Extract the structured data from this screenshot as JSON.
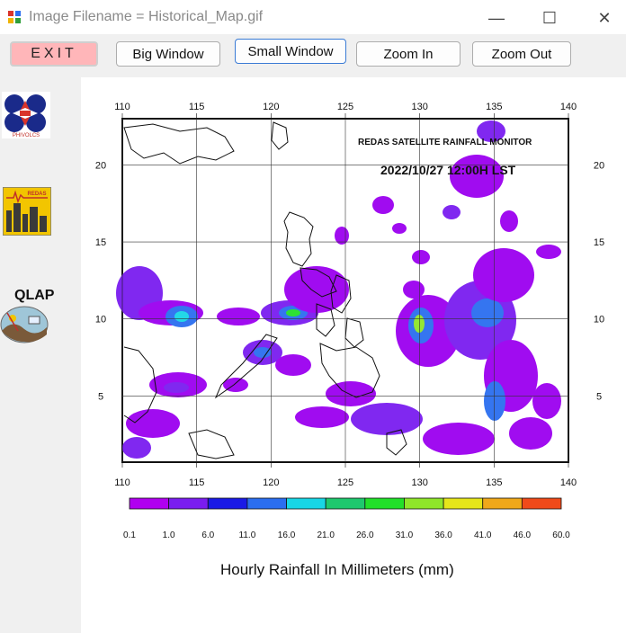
{
  "window": {
    "title": "Image Filename = Historical_Map.gif",
    "controls": {
      "minimize": "—",
      "maximize": "☐",
      "close": "✕"
    }
  },
  "toolbar": {
    "exit_label": "EXIT",
    "big_window_label": "Big Window",
    "small_window_label": "Small Window",
    "zoom_in_label": "Zoom In",
    "zoom_out_label": "Zoom Out"
  },
  "sidebar": {
    "logos": [
      "pagasa-phivolcs-logo",
      "redas-logo",
      "qlap-logo"
    ],
    "redas_text": "REDAS",
    "qlap_label": "QLAP"
  },
  "map": {
    "title": "REDAS SATELLITE RAINFALL MONITOR",
    "timestamp": "2022/10/27  12:00H LST",
    "x_ticks": [
      "110",
      "115",
      "120",
      "125",
      "130",
      "135",
      "140"
    ],
    "y_ticks": [
      "20",
      "15",
      "10",
      "5"
    ],
    "legend_values": [
      "0.1",
      "1.0",
      "6.0",
      "11.0",
      "16.0",
      "21.0",
      "26.0",
      "31.0",
      "36.0",
      "41.0",
      "46.0",
      "60.0"
    ],
    "legend_colors": [
      "#b000f0",
      "#7a1df0",
      "#1a1ae6",
      "#2b6ef0",
      "#18d6e6",
      "#1ec86e",
      "#22e02a",
      "#8fe62a",
      "#e6e61a",
      "#f0a81a",
      "#f04a1a"
    ],
    "legend_title": "Hourly Rainfall In Millimeters (mm)"
  }
}
